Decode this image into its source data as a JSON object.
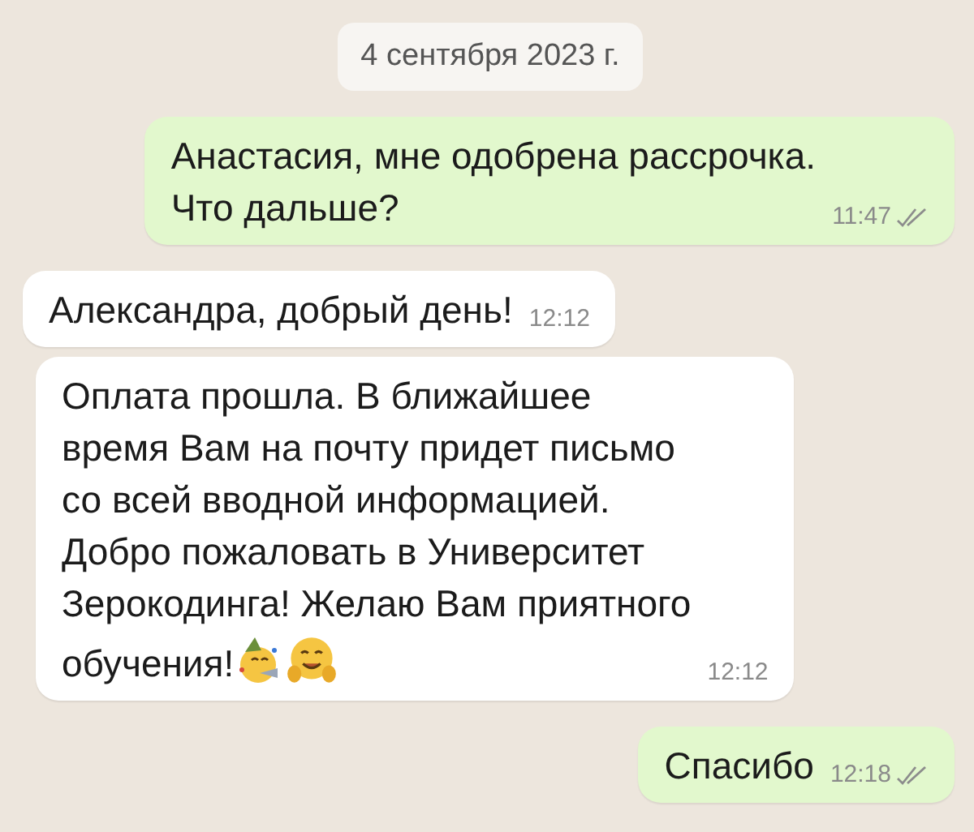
{
  "date_divider": "4 сентября 2023 г.",
  "messages": [
    {
      "kind": "outgoing",
      "text": "Анастасия, мне одобрена рассрочка.\nЧто дальше?",
      "time": "11:47",
      "delivered": true
    },
    {
      "kind": "incoming",
      "text": "Александра, добрый день!",
      "time": "12:12"
    },
    {
      "kind": "incoming",
      "text": "Оплата прошла. В ближайшее\nвремя Вам на почту придет письмо\nсо всей вводной информацией.\nДобро пожаловать в Университет\nЗерокодинга! Желаю Вам приятного\nобучения!",
      "time": "12:12",
      "ends_with_emoji": true
    },
    {
      "kind": "outgoing",
      "text": "Спасибо",
      "time": "12:18",
      "delivered": true
    }
  ]
}
